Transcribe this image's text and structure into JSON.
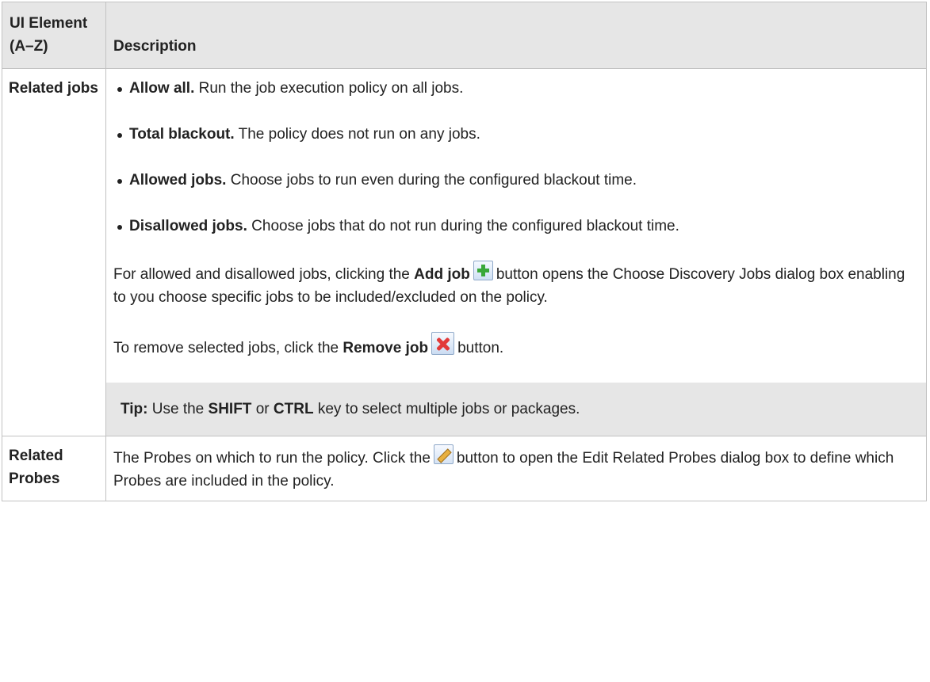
{
  "header": {
    "col1": "UI Element (A–Z)",
    "col2": "Description"
  },
  "rows": [
    {
      "name": "Related jobs",
      "options": [
        {
          "term": "Allow all.",
          "text": "Run the job execution policy on all jobs."
        },
        {
          "term": "Total blackout.",
          "text": "The policy does not run on any jobs."
        },
        {
          "term": "Allowed jobs.",
          "text": "Choose jobs to run even during the configured blackout time."
        },
        {
          "term": "Disallowed jobs.",
          "text": "Choose jobs that do not run during the configured blackout time."
        }
      ],
      "para1": {
        "pre": "For allowed and disallowed jobs, clicking the",
        "bold": "Add job",
        "post": "button opens the Choose Discovery Jobs dialog box enabling to you choose specific jobs to be included/excluded on the policy.",
        "icon": "add-job-icon"
      },
      "para2": {
        "pre": "To remove selected jobs, click the",
        "bold": "Remove job",
        "post": "button.",
        "icon": "remove-job-icon"
      },
      "tip": {
        "label": "Tip:",
        "pre": "Use the",
        "key1": "SHIFT",
        "mid": "or",
        "key2": "CTRL",
        "post": "key to select multiple jobs or packages."
      }
    },
    {
      "name": "Related Probes",
      "desc": {
        "pre": "The Probes on which to run the policy. Click the",
        "post": "button to open the Edit Related Probes dialog box to define which Probes are included in the policy.",
        "icon": "edit-pencil-icon"
      }
    }
  ]
}
